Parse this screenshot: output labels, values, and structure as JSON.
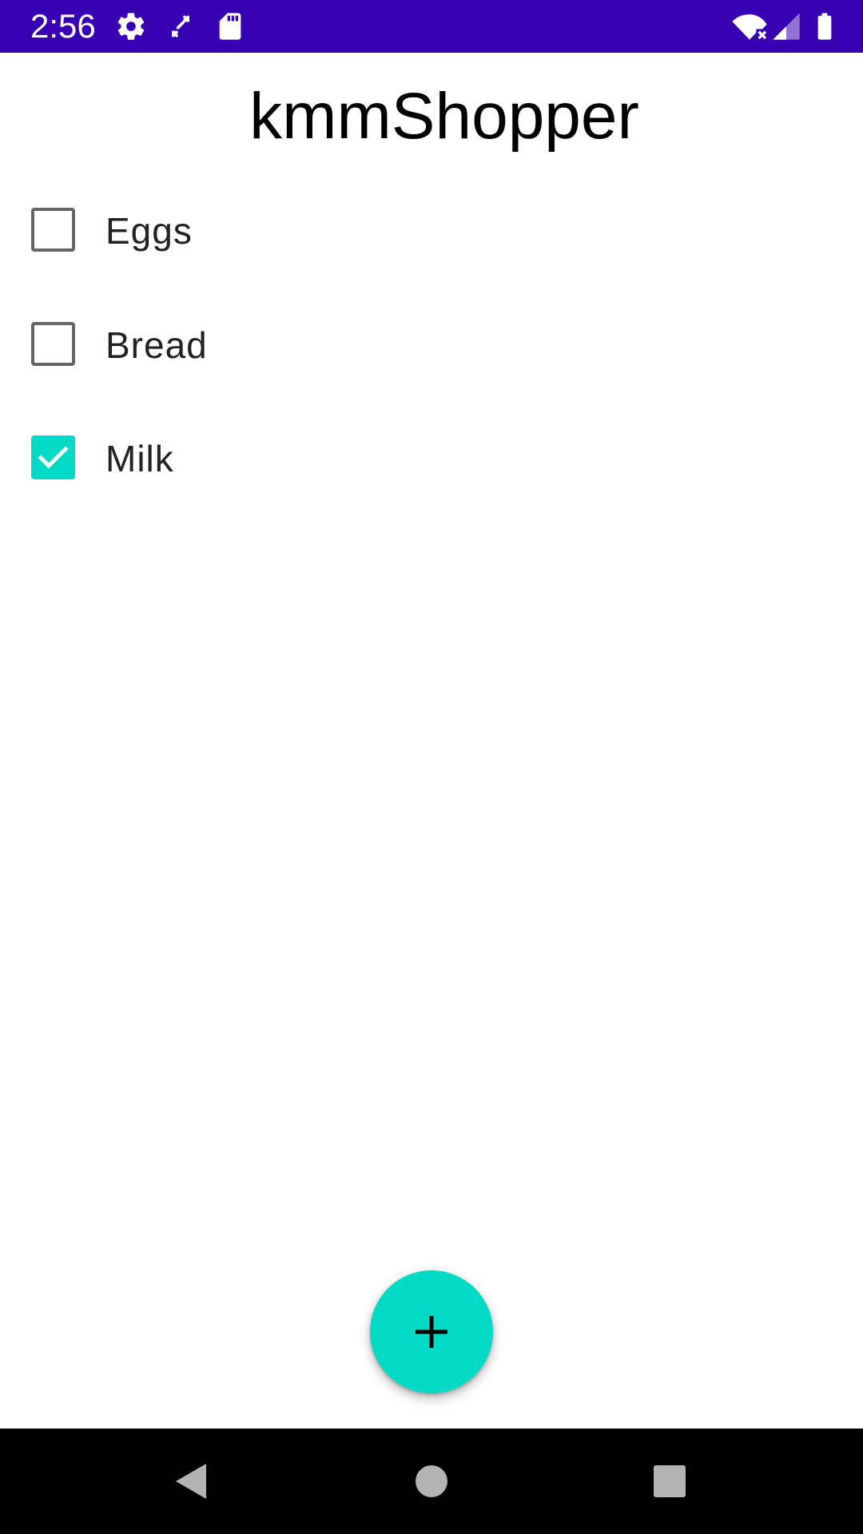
{
  "status_bar": {
    "time": "2:56",
    "background": "#3700b3",
    "icons": [
      "settings-gear-icon",
      "sync-icon",
      "sd-card-icon",
      "wifi-off-icon",
      "cell-signal-icon",
      "battery-icon"
    ]
  },
  "app": {
    "title": "kmmShopper",
    "accent": "#03dac5"
  },
  "shopping_list": {
    "items": [
      {
        "label": "Eggs",
        "checked": false
      },
      {
        "label": "Bread",
        "checked": false
      },
      {
        "label": "Milk",
        "checked": true
      }
    ]
  },
  "fab": {
    "icon": "plus-icon"
  },
  "nav_bar": {
    "buttons": [
      "back-icon",
      "home-icon",
      "recents-icon"
    ]
  }
}
